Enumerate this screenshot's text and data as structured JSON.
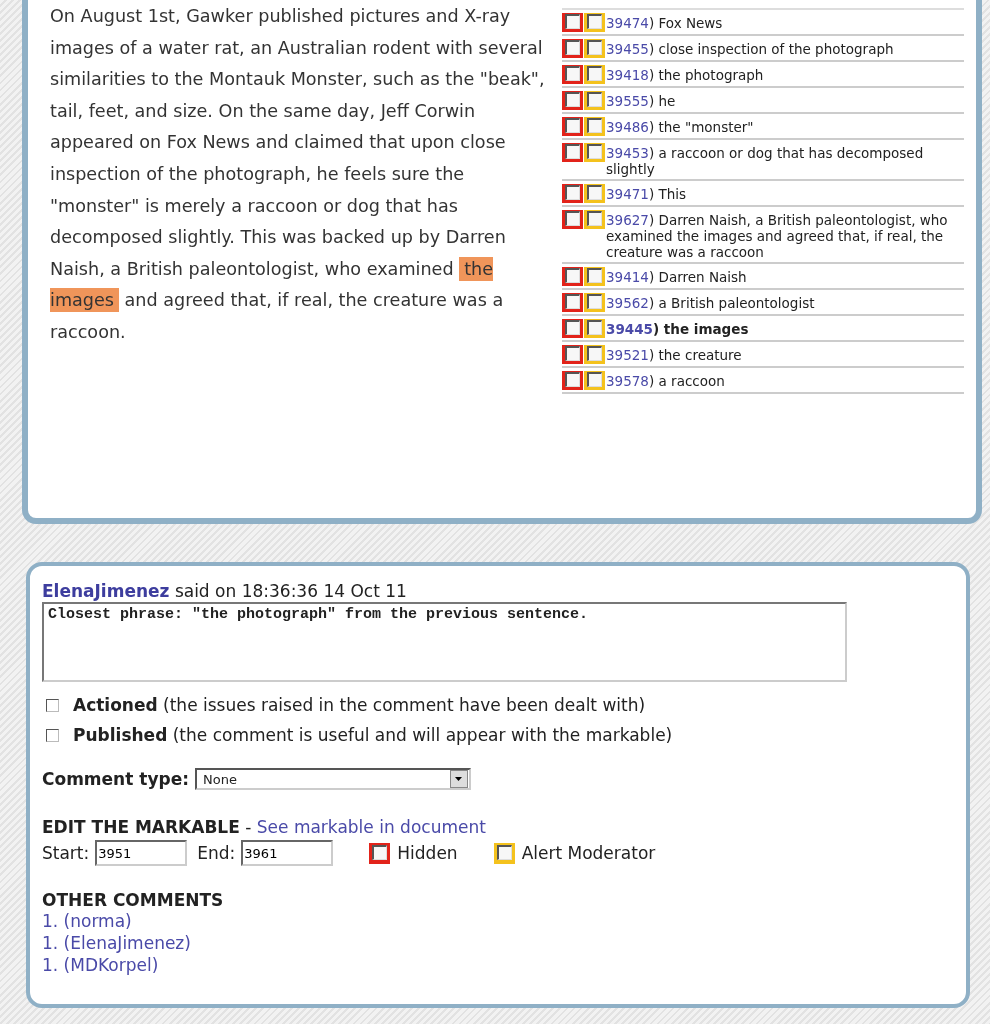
{
  "passage": {
    "before": "On August 1st, Gawker published pictures and X-ray images of a water rat, an Australian rodent with several similarities to the Montauk Monster, such as the \"beak\", tail, feet, and size. On the same day, Jeff Corwin appeared on Fox News and claimed that upon close inspection of the photograph, he feels sure the \"monster\" is merely a raccoon or dog that has decomposed slightly. This was backed up by Darren Naish, a British paleontologist, who examined ",
    "highlight": "the images",
    "after": " and agreed that, if real, the creature was a raccoon."
  },
  "markables": [
    {
      "id": "39474",
      "text": ") Fox News",
      "hidden": false,
      "alert": false,
      "selected": false
    },
    {
      "id": "39455",
      "text": ") close inspection of the photograph",
      "hidden": false,
      "alert": false,
      "selected": false
    },
    {
      "id": "39418",
      "text": ") the photograph",
      "hidden": false,
      "alert": false,
      "selected": false
    },
    {
      "id": "39555",
      "text": ") he",
      "hidden": false,
      "alert": false,
      "selected": false
    },
    {
      "id": "39486",
      "text": ") the \"monster\"",
      "hidden": false,
      "alert": false,
      "selected": false
    },
    {
      "id": "39453",
      "text": ") a raccoon or dog that has decomposed slightly",
      "hidden": false,
      "alert": false,
      "selected": false
    },
    {
      "id": "39471",
      "text": ") This",
      "hidden": false,
      "alert": false,
      "selected": false
    },
    {
      "id": "39627",
      "text": ") Darren Naish, a British paleontologist, who examined the images and agreed that, if real, the creature was a raccoon",
      "hidden": false,
      "alert": false,
      "selected": false
    },
    {
      "id": "39414",
      "text": ") Darren Naish",
      "hidden": false,
      "alert": false,
      "selected": false
    },
    {
      "id": "39562",
      "text": ") a British paleontologist",
      "hidden": false,
      "alert": false,
      "selected": false
    },
    {
      "id": "39445",
      "text": ") the images",
      "hidden": false,
      "alert": false,
      "selected": true
    },
    {
      "id": "39521",
      "text": ") the creature",
      "hidden": false,
      "alert": false,
      "selected": false
    },
    {
      "id": "39578",
      "text": ") a raccoon",
      "hidden": false,
      "alert": false,
      "selected": false
    }
  ],
  "comment": {
    "author": "ElenaJimenez",
    "said_on": "said on 18:36:36 14 Oct 11",
    "body": "Closest phrase: \"the photograph\" from the previous sentence.",
    "flags": [
      {
        "label": "Actioned",
        "description": "(the issues raised in the comment have been dealt with)",
        "checked": false
      },
      {
        "label": "Published",
        "description": "(the comment is useful and will appear with the markable)",
        "checked": false
      }
    ],
    "type_label": "Comment type:",
    "type_value": "None"
  },
  "edit": {
    "title": "EDIT THE MARKABLE",
    "separator": "-",
    "link": "See markable in document",
    "start_label": "Start:",
    "start": "3951",
    "end_label": "End:",
    "end": "3961",
    "hidden": {
      "label": "Hidden",
      "checked": false
    },
    "alert": {
      "label": "Alert Moderator",
      "checked": false
    }
  },
  "other_comments": {
    "title": "OTHER COMMENTS",
    "items": [
      "1. (norma)",
      "1. (ElenaJimenez)",
      "1. (MDKorpel)"
    ]
  }
}
